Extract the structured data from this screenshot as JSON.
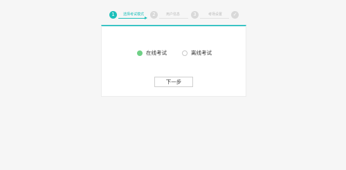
{
  "stepper": {
    "steps": [
      {
        "number": "1",
        "label": "选择考试模式",
        "state": "active"
      },
      {
        "number": "2",
        "label": "用户信息",
        "state": "inactive"
      },
      {
        "number": "3",
        "label": "考场设置",
        "state": "inactive"
      },
      {
        "number": "✓",
        "label": "",
        "state": "inactive"
      }
    ]
  },
  "mode_options": [
    {
      "label": "在线考试",
      "checked": true
    },
    {
      "label": "离线考试",
      "checked": false
    }
  ],
  "actions": {
    "next_label": "下一步"
  },
  "colors": {
    "accent": "#1cbfba",
    "radio_checked": "#6fd086",
    "background": "#f6f6f6"
  }
}
